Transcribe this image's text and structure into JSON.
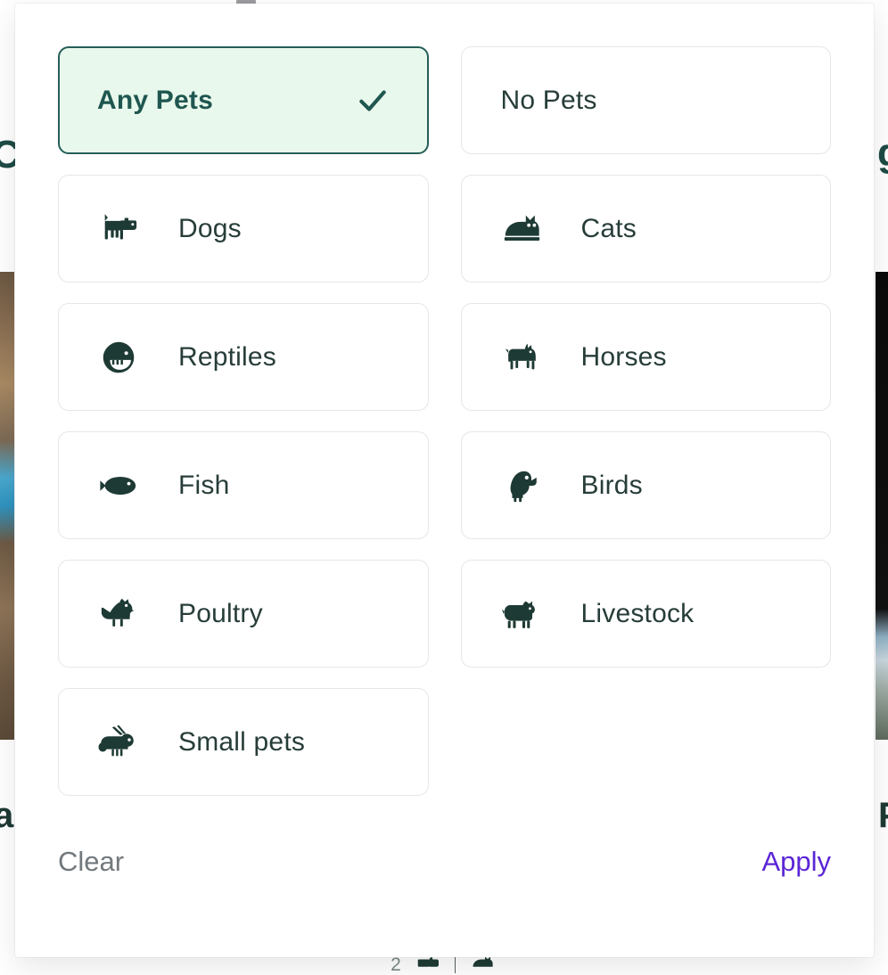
{
  "modal": {
    "name": "pets-filter-modal",
    "options": [
      {
        "id": "any-pets",
        "label": "Any Pets",
        "icon": null,
        "selected": true,
        "check": "check-icon"
      },
      {
        "id": "no-pets",
        "label": "No Pets",
        "icon": null,
        "selected": false
      },
      {
        "id": "dogs",
        "label": "Dogs",
        "icon": "dog-icon",
        "selected": false
      },
      {
        "id": "cats",
        "label": "Cats",
        "icon": "cat-icon",
        "selected": false
      },
      {
        "id": "reptiles",
        "label": "Reptiles",
        "icon": "reptile-icon",
        "selected": false
      },
      {
        "id": "horses",
        "label": "Horses",
        "icon": "horse-icon",
        "selected": false
      },
      {
        "id": "fish",
        "label": "Fish",
        "icon": "fish-icon",
        "selected": false
      },
      {
        "id": "birds",
        "label": "Birds",
        "icon": "bird-icon",
        "selected": false
      },
      {
        "id": "poultry",
        "label": "Poultry",
        "icon": "poultry-icon",
        "selected": false
      },
      {
        "id": "livestock",
        "label": "Livestock",
        "icon": "livestock-icon",
        "selected": false
      },
      {
        "id": "small-pets",
        "label": "Small pets",
        "icon": "rabbit-icon",
        "selected": false
      }
    ],
    "footer": {
      "clear_label": "Clear",
      "apply_label": "Apply"
    }
  },
  "background": {
    "heading_left_fragment": "C",
    "heading_right_fragment": "g",
    "text_left_low_fragment": "a",
    "text_right_low_fragment": "P",
    "bottom_bar": {
      "dog_count": "2"
    }
  },
  "colors": {
    "selected_border": "#255E58",
    "selected_fill": "#E9F8EC",
    "selected_text": "#1F5650",
    "icon": "#1E3A34",
    "option_border": "#E6E6E6",
    "option_text": "#273d39",
    "clear_text": "#72797D",
    "apply_text": "#5B26D6"
  }
}
